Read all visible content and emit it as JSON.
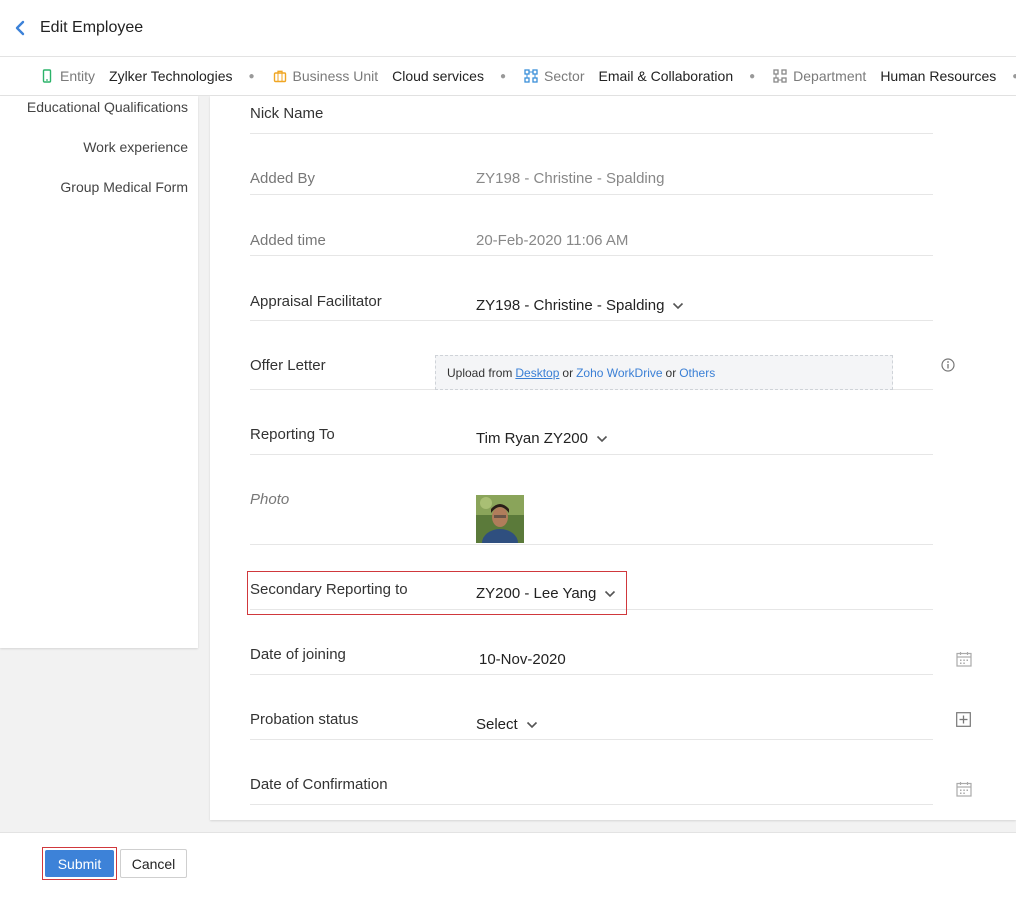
{
  "header": {
    "title": "Edit Employee"
  },
  "breadcrumbs": [
    {
      "key": "Entity",
      "value": "Zylker Technologies",
      "icon": "mobile-icon",
      "color": "#2bb36a"
    },
    {
      "key": "Business Unit",
      "value": "Cloud services",
      "icon": "briefcase-icon",
      "color": "#f0a623"
    },
    {
      "key": "Sector",
      "value": "Email & Collaboration",
      "icon": "nodes-icon",
      "color": "#3a8fd9"
    },
    {
      "key": "Department",
      "value": "Human Resources",
      "icon": "hierarchy-icon",
      "color": "#888888"
    }
  ],
  "sidebar": {
    "items": [
      {
        "label": "Educational Qualifications"
      },
      {
        "label": "Work experience"
      },
      {
        "label": "Group Medical Form"
      }
    ]
  },
  "form": {
    "nick_name": {
      "label": "Nick Name",
      "value": ""
    },
    "added_by": {
      "label": "Added By",
      "value": "ZY198 - Christine - Spalding"
    },
    "added_time": {
      "label": "Added time",
      "value": "20-Feb-2020 11:06 AM"
    },
    "appraisal_facilitator": {
      "label": "Appraisal Facilitator",
      "value": "ZY198 - Christine - Spalding"
    },
    "offer_letter": {
      "label": "Offer Letter",
      "upload_prefix": "Upload from",
      "desktop": "Desktop",
      "or1": "or",
      "workdrive": "Zoho WorkDrive",
      "or2": "or",
      "others": "Others"
    },
    "reporting_to": {
      "label": "Reporting To",
      "value": "Tim Ryan ZY200"
    },
    "photo": {
      "label": "Photo"
    },
    "secondary_reporting": {
      "label": "Secondary Reporting to",
      "value": "ZY200 - Lee Yang"
    },
    "date_of_joining": {
      "label": "Date of joining",
      "value": "10-Nov-2020"
    },
    "probation_status": {
      "label": "Probation status",
      "value": "Select"
    },
    "date_of_confirmation": {
      "label": "Date of Confirmation",
      "value": ""
    }
  },
  "footer": {
    "submit_label": "Submit",
    "cancel_label": "Cancel"
  },
  "colors": {
    "accent": "#3d82d8",
    "highlight": "#d0383c"
  }
}
